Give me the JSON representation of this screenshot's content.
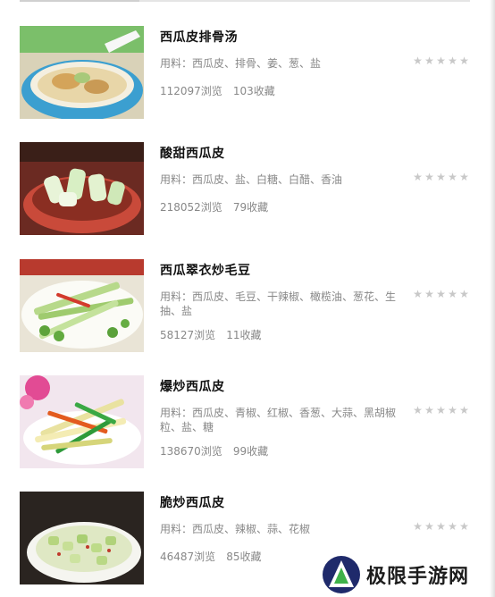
{
  "recipes": [
    {
      "title": "西瓜皮排骨汤",
      "ingredients": "用料：西瓜皮、排骨、姜、葱、盐",
      "views": "112097浏览",
      "favorites": "103收藏",
      "rating_stars": 5
    },
    {
      "title": "酸甜西瓜皮",
      "ingredients": "用料：西瓜皮、盐、白糖、白醋、香油",
      "views": "218052浏览",
      "favorites": "79收藏",
      "rating_stars": 5
    },
    {
      "title": "西瓜翠衣炒毛豆",
      "ingredients": "用料：西瓜皮、毛豆、干辣椒、橄榄油、葱花、生抽、盐",
      "views": "58127浏览",
      "favorites": "11收藏",
      "rating_stars": 5
    },
    {
      "title": "爆炒西瓜皮",
      "ingredients": "用料：西瓜皮、青椒、红椒、香葱、大蒜、黑胡椒粒、盐、糖",
      "views": "138670浏览",
      "favorites": "99收藏",
      "rating_stars": 5
    },
    {
      "title": "脆炒西瓜皮",
      "ingredients": "用料：西瓜皮、辣椒、蒜、花椒",
      "views": "46487浏览",
      "favorites": "85收藏",
      "rating_stars": 5
    }
  ],
  "watermark": {
    "text": "极限手游网"
  },
  "colors": {
    "star_empty": "#c8c8c8",
    "meta_text": "#888888",
    "title_text": "#111111"
  }
}
